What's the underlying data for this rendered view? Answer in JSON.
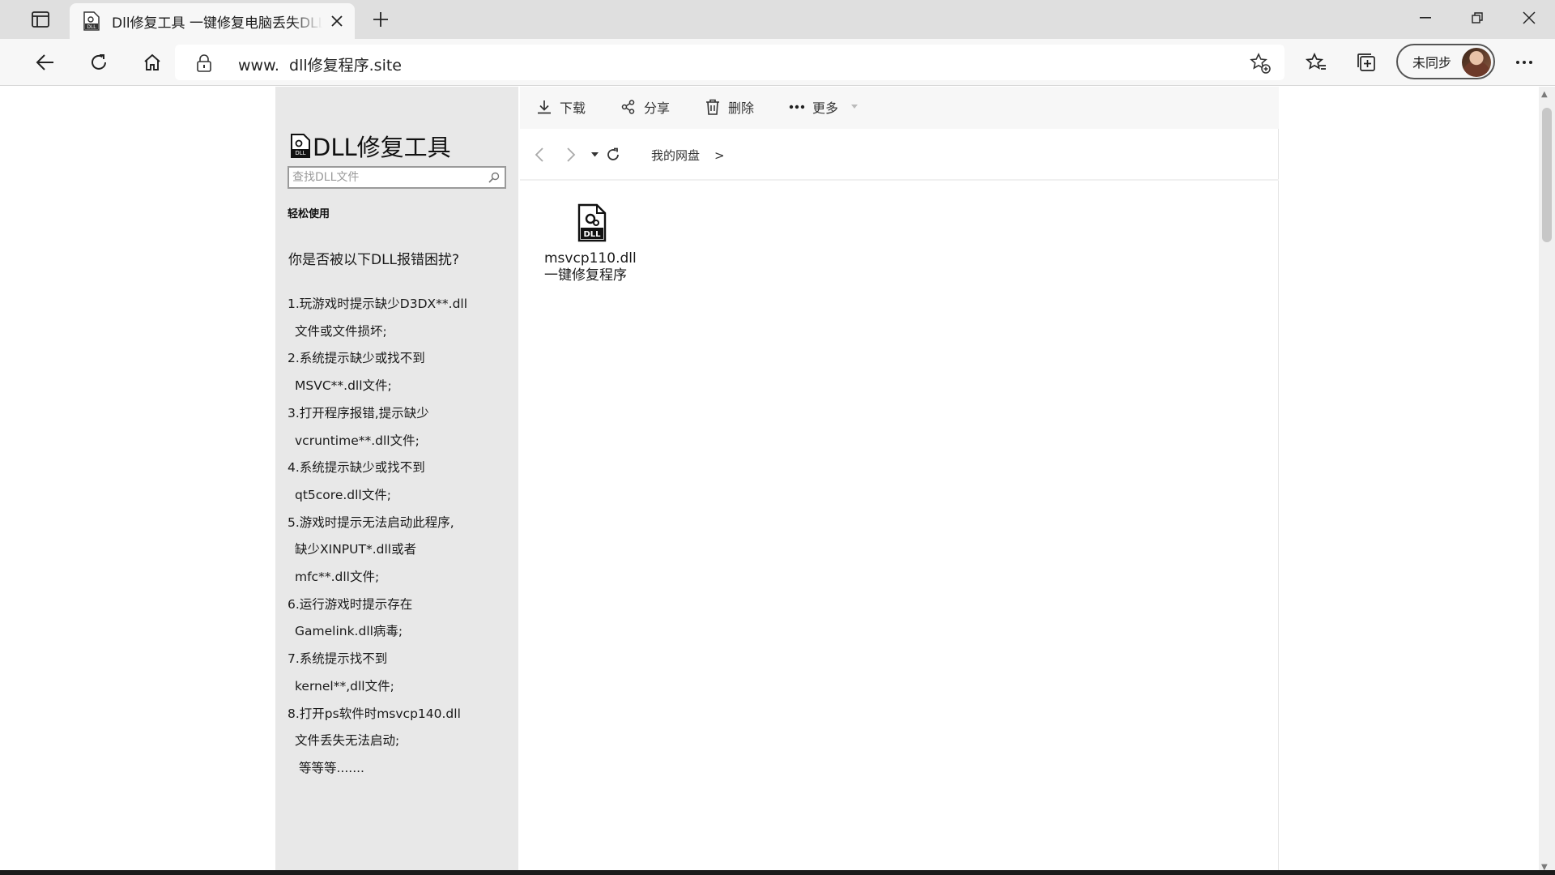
{
  "browser": {
    "tab": {
      "title": "Dll修复工具 一键修复电脑丢失DLL",
      "favicon": "dll-file-icon"
    },
    "address": {
      "prefix": "www.",
      "host": "dll修复程序.site"
    },
    "profile": {
      "label": "未同步"
    },
    "icons": [
      "sidebar-icon",
      "close-icon",
      "plus-icon",
      "minimize-icon",
      "restore-icon",
      "back-icon",
      "refresh-icon",
      "home-icon",
      "lock-icon",
      "add-favorite-icon",
      "favorites-icon",
      "collections-icon",
      "more-icon"
    ]
  },
  "sidebar": {
    "logo_text": "DLL修复工具",
    "search_placeholder": "查找DLL文件",
    "easy_use": "轻松使用",
    "issues_heading": "你是否被以下DLL报错困扰?",
    "issues": [
      {
        "text": "1.玩游戏时提示缺少D3DX**.dll",
        "indent": 0
      },
      {
        "text": "文件或文件损坏;",
        "indent": 1
      },
      {
        "text": "2.系统提示缺少或找不到",
        "indent": 0
      },
      {
        "text": "MSVC**.dll文件;",
        "indent": 1
      },
      {
        "text": "3.打开程序报错,提示缺少",
        "indent": 0
      },
      {
        "text": "vcruntime**.dll文件;",
        "indent": 1
      },
      {
        "text": "4.系统提示缺少或找不到",
        "indent": 0
      },
      {
        "text": "qt5core.dll文件;",
        "indent": 1
      },
      {
        "text": "5.游戏时提示无法启动此程序,",
        "indent": 0
      },
      {
        "text": "缺少XINPUT*.dll或者",
        "indent": 1
      },
      {
        "text": "mfc**.dll文件;",
        "indent": 1
      },
      {
        "text": "6.运行游戏时提示存在",
        "indent": 0
      },
      {
        "text": "Gamelink.dll病毒;",
        "indent": 1
      },
      {
        "text": "7.系统提示找不到",
        "indent": 0
      },
      {
        "text": "kernel**,dll文件;",
        "indent": 1
      },
      {
        "text": "8.打开ps软件时msvcp140.dll",
        "indent": 0
      },
      {
        "text": "文件丢失无法启动;",
        "indent": 1
      },
      {
        "text": "等等等.......",
        "indent": 2
      }
    ]
  },
  "file_manager": {
    "actions": {
      "download": "下载",
      "share": "分享",
      "delete": "删除",
      "more": "更多"
    },
    "breadcrumb": {
      "root": "我的网盘",
      "separator": ">"
    },
    "file": {
      "name_line1": "msvcp110.dll",
      "name_line2": "一键修复程序",
      "icon_label": "DLL"
    }
  }
}
